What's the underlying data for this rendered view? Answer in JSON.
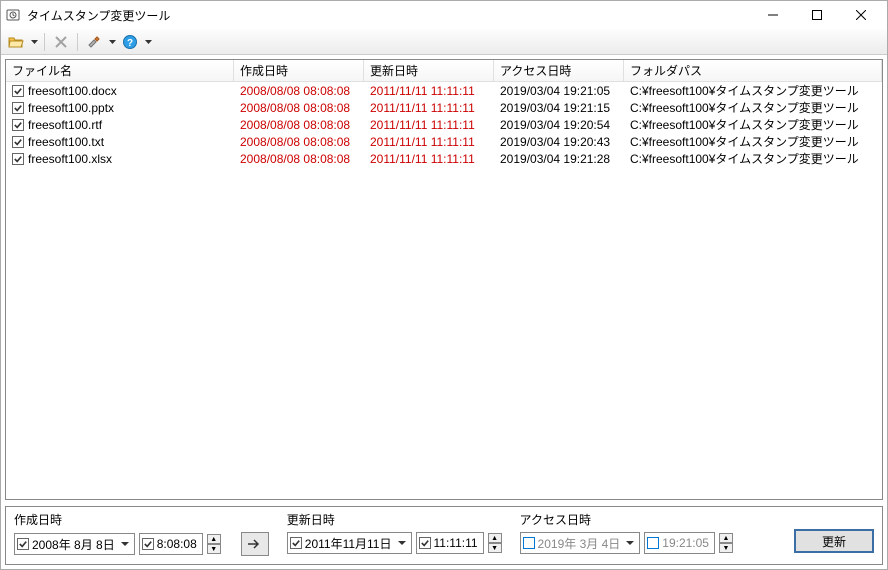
{
  "window": {
    "title": "タイムスタンプ変更ツール"
  },
  "columns": {
    "name": "ファイル名",
    "created": "作成日時",
    "modified": "更新日時",
    "accessed": "アクセス日時",
    "folder": "フォルダパス"
  },
  "rows": [
    {
      "name": "freesoft100.docx",
      "created": "2008/08/08 08:08:08",
      "modified": "2011/11/11 11:11:11",
      "accessed": "2019/03/04 19:21:05",
      "folder": "C:¥freesoft100¥タイムスタンプ変更ツール"
    },
    {
      "name": "freesoft100.pptx",
      "created": "2008/08/08 08:08:08",
      "modified": "2011/11/11 11:11:11",
      "accessed": "2019/03/04 19:21:15",
      "folder": "C:¥freesoft100¥タイムスタンプ変更ツール"
    },
    {
      "name": "freesoft100.rtf",
      "created": "2008/08/08 08:08:08",
      "modified": "2011/11/11 11:11:11",
      "accessed": "2019/03/04 19:20:54",
      "folder": "C:¥freesoft100¥タイムスタンプ変更ツール"
    },
    {
      "name": "freesoft100.txt",
      "created": "2008/08/08 08:08:08",
      "modified": "2011/11/11 11:11:11",
      "accessed": "2019/03/04 19:20:43",
      "folder": "C:¥freesoft100¥タイムスタンプ変更ツール"
    },
    {
      "name": "freesoft100.xlsx",
      "created": "2008/08/08 08:08:08",
      "modified": "2011/11/11 11:11:11",
      "accessed": "2019/03/04 19:21:28",
      "folder": "C:¥freesoft100¥タイムスタンプ変更ツール"
    }
  ],
  "bottom": {
    "created": {
      "label": "作成日時",
      "date": "2008年 8月 8日",
      "time": "8:08:08",
      "checked": true
    },
    "modified": {
      "label": "更新日時",
      "date": "2011年11月11日",
      "time": "11:11:11",
      "checked": true
    },
    "accessed": {
      "label": "アクセス日時",
      "date": "2019年 3月 4日",
      "time": "19:21:05",
      "checked": false
    },
    "update_label": "更新"
  }
}
